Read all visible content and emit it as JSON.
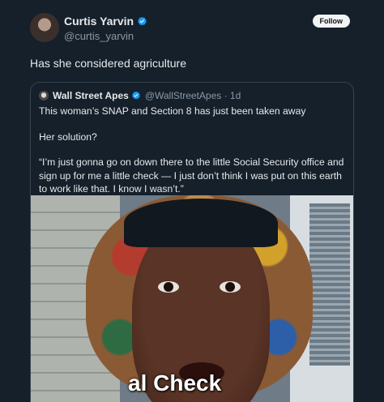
{
  "author": {
    "display_name": "Curtis Yarvin",
    "handle": "@curtis_yarvin",
    "verified_icon": "verified-badge-icon",
    "follow_label": "Follow"
  },
  "tweet": {
    "text": "Has she considered agriculture"
  },
  "quote": {
    "display_name": "Wall Street Apes",
    "handle_time": "@WallStreetApes · 1d",
    "paragraphs": [
      "This woman’s SNAP and Section 8 has just been taken away",
      "Her solution?",
      "“I’m just gonna go on down there to the little Social Security office and sign up for me a little check — I just don’t think I was put on this earth to work like that. I know I wasn’t.”"
    ],
    "video_caption": "al Check"
  },
  "colors": {
    "background": "#15202b",
    "text": "#e7e9ea",
    "muted": "#8b98a5",
    "verified": "#1d9bf0",
    "border": "#38444d"
  }
}
